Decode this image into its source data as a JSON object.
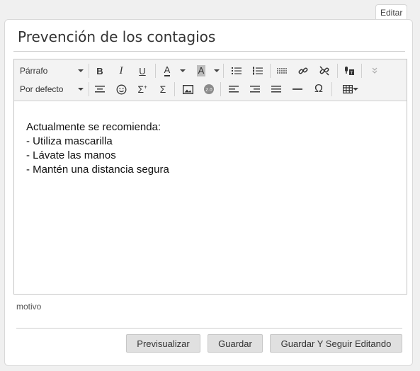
{
  "tab": {
    "edit_label": "Editar"
  },
  "card": {
    "title": "Prevención de los contagios"
  },
  "toolbar": {
    "block_format": "Párrafo",
    "font_family": "Por defecto",
    "bold": "B",
    "italic": "I",
    "underline": "U",
    "text_color": "A",
    "bg_color": "A",
    "special_char": "Ω",
    "icons": [
      "bold-icon",
      "italic-icon",
      "underline-icon",
      "text-color-icon",
      "background-color-icon",
      "bullet-list-icon",
      "numbered-list-icon",
      "clean-format-icon",
      "link-icon",
      "unlink-icon",
      "speech-to-text-icon",
      "expand-toolbar-icon",
      "align-center-icon",
      "emoji-icon",
      "sum-plus-icon",
      "sum-icon",
      "image-icon",
      "badge-20-icon",
      "align-left-icon",
      "align-right-icon",
      "align-justify-icon",
      "horizontal-rule-icon",
      "omega-icon",
      "table-icon"
    ]
  },
  "editor": {
    "lines": [
      "Actualmente se recomienda:",
      "- Utiliza mascarilla",
      "- Lávate las manos",
      "- Mantén una distancia segura"
    ]
  },
  "footer": {
    "motivo_label": "motivo",
    "preview_button": "Previsualizar",
    "save_button": "Guardar",
    "save_continue_button": "Guardar Y Seguir Editando"
  },
  "colors": {
    "accent_text_color_underline": "#333333",
    "bg_color_swatch": "#bdbdbd"
  }
}
